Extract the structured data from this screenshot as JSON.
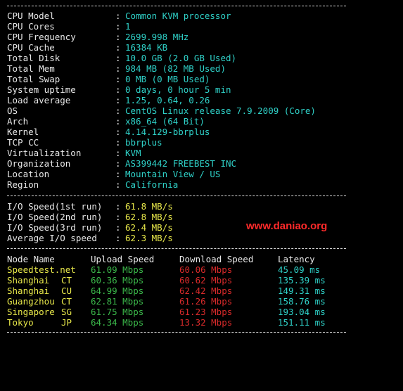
{
  "colors": {
    "background": "#000000",
    "label": "#e8e8e8",
    "value": "#2fd1c8",
    "io_value": "#e8e84a",
    "upload": "#3bb84a",
    "download": "#d82a2a",
    "node": "#e8e84a",
    "watermark": "#ff2a2a"
  },
  "system_info": [
    {
      "label": "CPU Model",
      "value": "Common KVM processor"
    },
    {
      "label": "CPU Cores",
      "value": "1"
    },
    {
      "label": "CPU Frequency",
      "value": "2699.998 MHz"
    },
    {
      "label": "CPU Cache",
      "value": "16384 KB"
    },
    {
      "label": "Total Disk",
      "value": "10.0 GB (2.0 GB Used)"
    },
    {
      "label": "Total Mem",
      "value": "984 MB (82 MB Used)"
    },
    {
      "label": "Total Swap",
      "value": "0 MB (0 MB Used)"
    },
    {
      "label": "System uptime",
      "value": "0 days, 0 hour 5 min"
    },
    {
      "label": "Load average",
      "value": "1.25, 0.64, 0.26"
    },
    {
      "label": "OS",
      "value": "CentOS Linux release 7.9.2009 (Core)"
    },
    {
      "label": "Arch",
      "value": "x86_64 (64 Bit)"
    },
    {
      "label": "Kernel",
      "value": "4.14.129-bbrplus"
    },
    {
      "label": "TCP CC",
      "value": "bbrplus"
    },
    {
      "label": "Virtualization",
      "value": "KVM"
    },
    {
      "label": "Organization",
      "value": "AS399442 FREEBEST INC"
    },
    {
      "label": "Location",
      "value": "Mountain View / US"
    },
    {
      "label": "Region",
      "value": "California"
    }
  ],
  "io_speed": [
    {
      "label": "I/O Speed(1st run)",
      "value": "61.8 MB/s"
    },
    {
      "label": "I/O Speed(2nd run)",
      "value": "62.8 MB/s"
    },
    {
      "label": "I/O Speed(3rd run)",
      "value": "62.4 MB/s"
    },
    {
      "label": "Average I/O speed",
      "value": "62.3 MB/s"
    }
  ],
  "colon": ":",
  "watermark": "www.daniao.org",
  "speedtest": {
    "headers": {
      "node": "Node Name",
      "upload": "Upload Speed",
      "download": "Download Speed",
      "latency": "Latency"
    },
    "rows": [
      {
        "node": "Speedtest.net",
        "isp": "",
        "upload": "61.09 Mbps",
        "download": "60.06 Mbps",
        "latency": "45.09 ms"
      },
      {
        "node": "Shanghai",
        "isp": "CT",
        "upload": "60.36 Mbps",
        "download": "60.62 Mbps",
        "latency": "135.39 ms"
      },
      {
        "node": "Shanghai",
        "isp": "CU",
        "upload": "64.99 Mbps",
        "download": "62.42 Mbps",
        "latency": "149.31 ms"
      },
      {
        "node": "Guangzhou",
        "isp": "CT",
        "upload": "62.81 Mbps",
        "download": "61.26 Mbps",
        "latency": "158.76 ms"
      },
      {
        "node": "Singapore",
        "isp": "SG",
        "upload": "61.75 Mbps",
        "download": "61.23 Mbps",
        "latency": "193.04 ms"
      },
      {
        "node": "Tokyo",
        "isp": "JP",
        "upload": "64.34 Mbps",
        "download": "13.32 Mbps",
        "latency": "151.11 ms"
      }
    ]
  }
}
